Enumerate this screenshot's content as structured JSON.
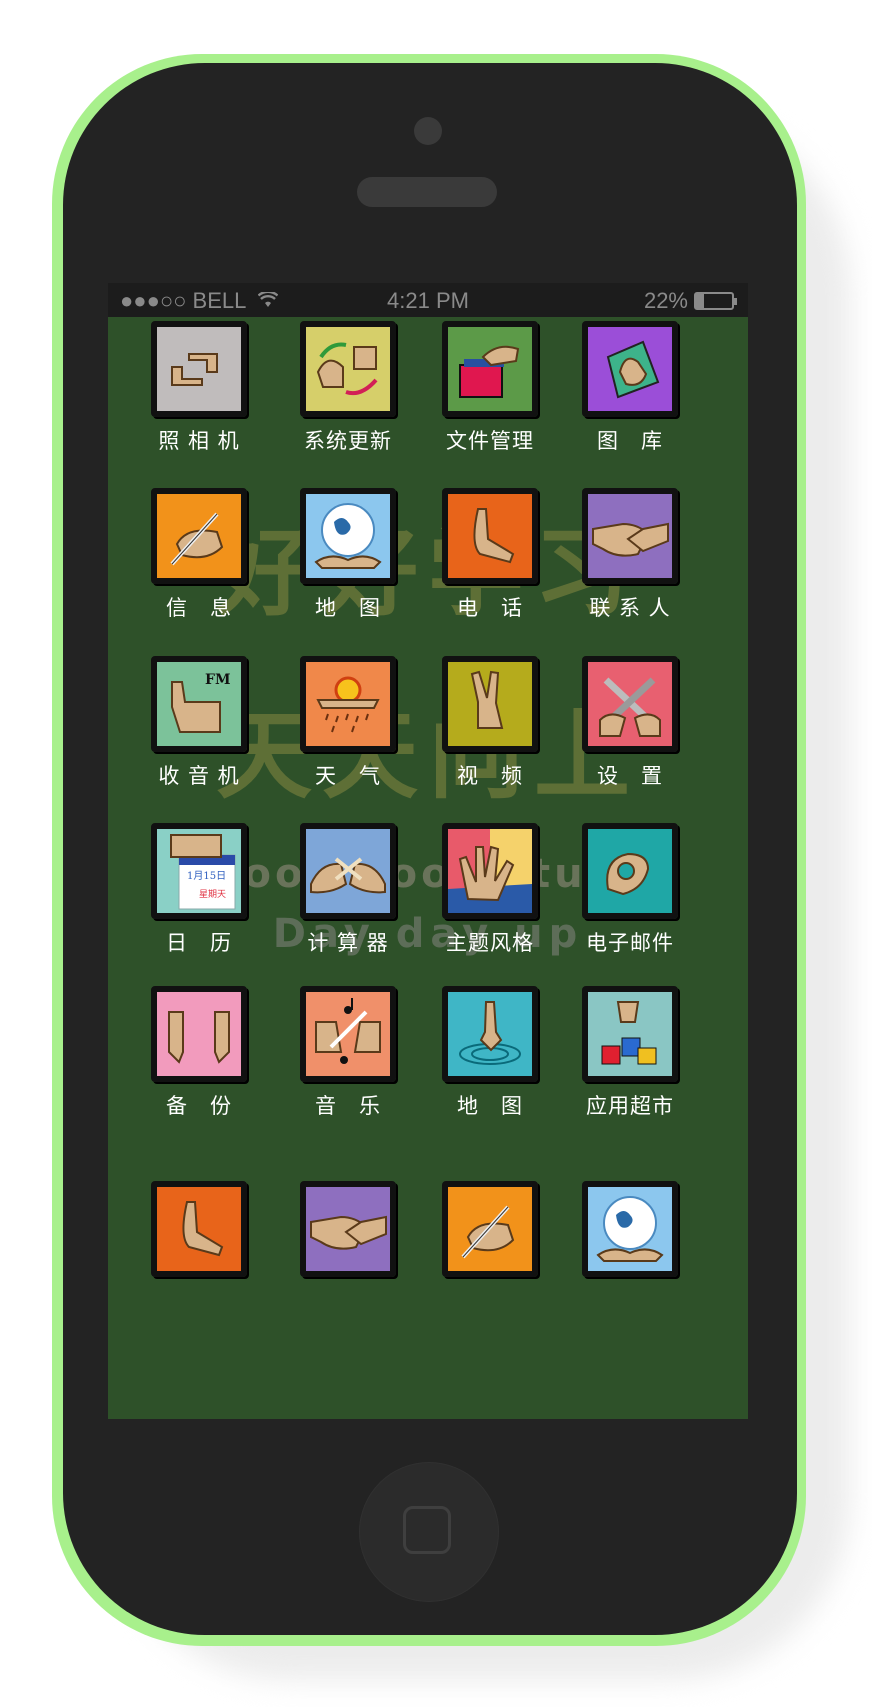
{
  "status_bar": {
    "carrier": "●●●○○ BELL",
    "time": "4:21 PM",
    "battery": "22%",
    "battery_level": 0.22
  },
  "watermark": [
    "好好学习",
    "天天向上",
    "Good good study",
    "Day day up"
  ],
  "apps": [
    {
      "label": "照 相 机",
      "icon": "camera-hands-icon",
      "color": "#c0bcbc"
    },
    {
      "label": "系统更新",
      "icon": "system-update-icon",
      "color": "#d6cf6a"
    },
    {
      "label": "文件管理",
      "icon": "file-manager-icon",
      "color": "#5c9a48"
    },
    {
      "label": "图　库",
      "icon": "gallery-icon",
      "color": "#9b4ed8"
    },
    {
      "label": "信　息",
      "icon": "message-pen-icon",
      "color": "#f2921a"
    },
    {
      "label": "地　图",
      "icon": "globe-map-icon",
      "color": "#8cc7ee"
    },
    {
      "label": "电　话",
      "icon": "phone-hand-icon",
      "color": "#e8641a"
    },
    {
      "label": "联 系 人",
      "icon": "handshake-icon",
      "color": "#8e6fbf"
    },
    {
      "label": "收 音 机",
      "icon": "radio-fm-icon",
      "color": "#7cc29a"
    },
    {
      "label": "天　气",
      "icon": "weather-icon",
      "color": "#f0884a"
    },
    {
      "label": "视　频",
      "icon": "video-peace-icon",
      "color": "#b5ab1c"
    },
    {
      "label": "设　置",
      "icon": "settings-wrench-icon",
      "color": "#e86070"
    },
    {
      "label": "日　历",
      "icon": "calendar-icon",
      "color": "#8ad0c6"
    },
    {
      "label": "计 算 器",
      "icon": "calculator-icon",
      "color": "#7ea6d8"
    },
    {
      "label": "主题风格",
      "icon": "theme-hand-icon",
      "color": "#f5d26b"
    },
    {
      "label": "电子邮件",
      "icon": "email-hand-icon",
      "color": "#1fa7a6"
    },
    {
      "label": "备　份",
      "icon": "backup-hands-icon",
      "color": "#f29bbd"
    },
    {
      "label": "音　乐",
      "icon": "music-hands-icon",
      "color": "#f0906a"
    },
    {
      "label": "地　图",
      "icon": "map-ripple-icon",
      "color": "#3fb6c6"
    },
    {
      "label": "应用超市",
      "icon": "app-store-icon",
      "color": "#8ac6c4"
    },
    {
      "label": "",
      "icon": "phone-hand-icon",
      "color": "#e8641a"
    },
    {
      "label": "",
      "icon": "handshake-icon",
      "color": "#8e6fbf"
    },
    {
      "label": "",
      "icon": "message-pen-icon",
      "color": "#f2921a"
    },
    {
      "label": "",
      "icon": "globe-map-icon",
      "color": "#8cc7ee"
    }
  ],
  "calendar_icon": {
    "date": "1月15日",
    "weekday": "星期天"
  },
  "radio_icon": {
    "text": "FM"
  }
}
